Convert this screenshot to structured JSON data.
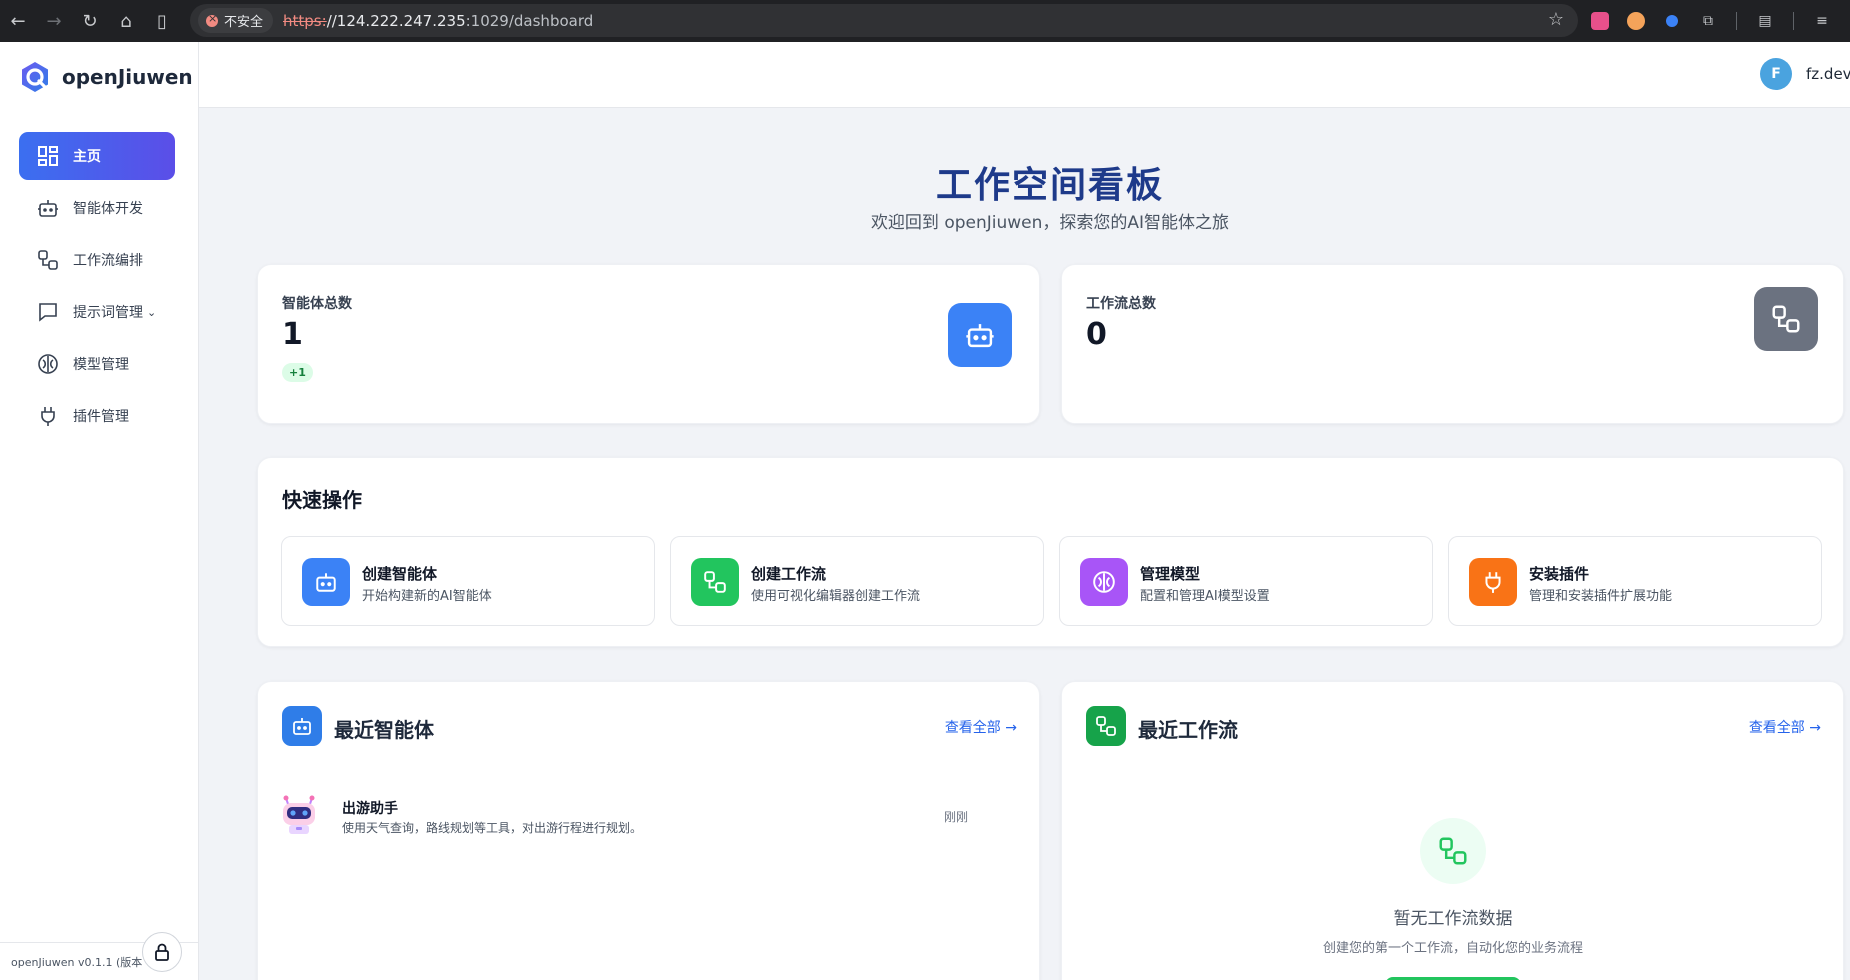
{
  "browser": {
    "security_label": "不安全",
    "url_scheme": "https:",
    "url_host": "//124.222.247.235",
    "url_rest": ":1029/dashboard"
  },
  "brand": {
    "name": "openJiuwen"
  },
  "sidebar": {
    "items": [
      {
        "label": "主页",
        "icon": "dashboard-icon",
        "active": true
      },
      {
        "label": "智能体开发",
        "icon": "robot-icon"
      },
      {
        "label": "工作流编排",
        "icon": "workflow-icon"
      },
      {
        "label": "提示词管理",
        "icon": "message-icon",
        "has_submenu": true
      },
      {
        "label": "模型管理",
        "icon": "brain-icon"
      },
      {
        "label": "插件管理",
        "icon": "plug-icon"
      }
    ],
    "footer_version": "openJiuwen v0.1.1 (版本"
  },
  "user": {
    "initial": "F",
    "name": "fz.dev"
  },
  "hero": {
    "title": "工作空间看板",
    "subtitle": "欢迎回到 openJiuwen，探索您的AI智能体之旅"
  },
  "stats": {
    "agents": {
      "label": "智能体总数",
      "value": "1",
      "badge": "+1",
      "color": "#3b82f6"
    },
    "workflows": {
      "label": "工作流总数",
      "value": "0",
      "color": "#6b7280"
    }
  },
  "quick_actions": {
    "title": "快速操作",
    "items": [
      {
        "name": "创建智能体",
        "desc": "开始构建新的AI智能体",
        "icon": "robot-icon",
        "color": "#3b82f6"
      },
      {
        "name": "创建工作流",
        "desc": "使用可视化编辑器创建工作流",
        "icon": "workflow-icon",
        "color": "#22c55e"
      },
      {
        "name": "管理模型",
        "desc": "配置和管理AI模型设置",
        "icon": "brain-icon",
        "color": "#a855f7"
      },
      {
        "name": "安装插件",
        "desc": "管理和安装插件扩展功能",
        "icon": "plug-icon",
        "color": "#f97316"
      }
    ]
  },
  "recent_agents": {
    "title": "最近智能体",
    "view_all": "查看全部 →",
    "items": [
      {
        "name": "出游助手",
        "desc": "使用天气查询，路线规划等工具，对出游行程进行规划。",
        "time": "刚刚"
      }
    ]
  },
  "recent_workflows": {
    "title": "最近工作流",
    "view_all": "查看全部 →",
    "empty_title": "暂无工作流数据",
    "empty_desc": "创建您的第一个工作流，自动化您的业务流程"
  }
}
